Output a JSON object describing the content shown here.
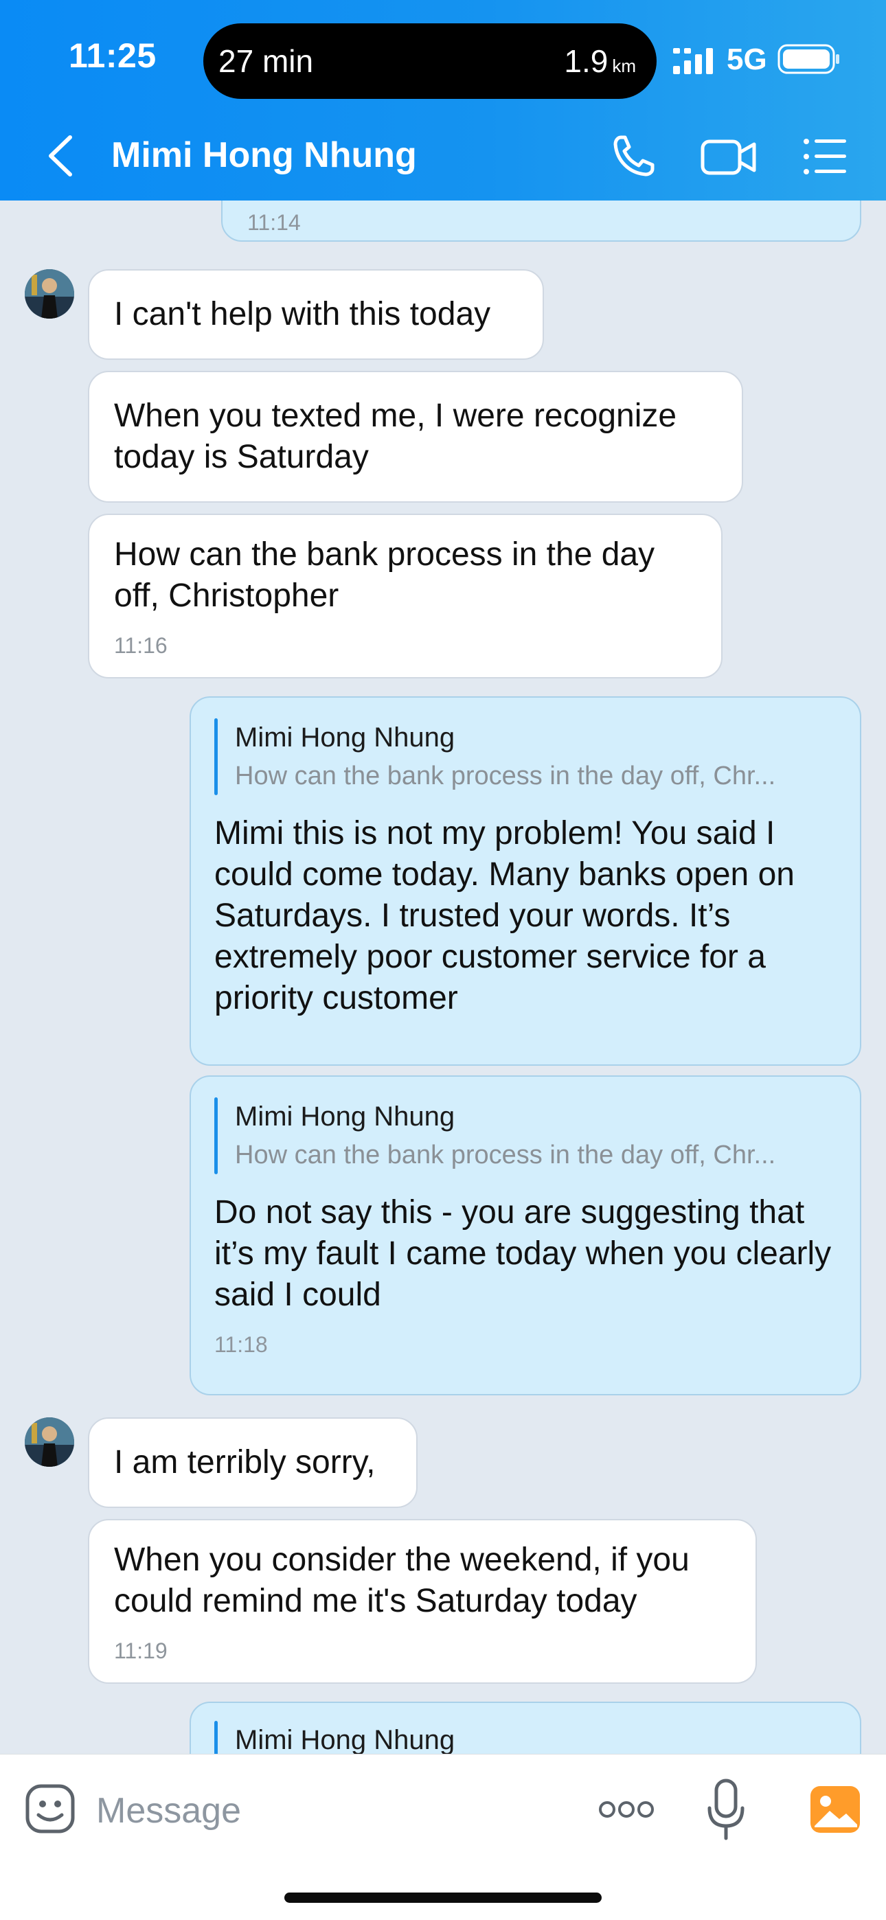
{
  "status_bar": {
    "time": "11:25",
    "island_left": "27 min",
    "island_distance": "1.9",
    "island_unit": "km",
    "network": "5G"
  },
  "nav": {
    "title": "Mimi Hong Nhung",
    "icons": [
      "back-icon",
      "phone-icon",
      "video-call-icon",
      "menu-list-icon"
    ]
  },
  "messages": [
    {
      "dir": "out",
      "time": "11:14"
    },
    {
      "dir": "in",
      "text": "I can't help with this today"
    },
    {
      "dir": "in",
      "text": "When you texted me, I were recognize today is Saturday"
    },
    {
      "dir": "in",
      "text": "How can the bank process in the day off, Christopher",
      "time": "11:16"
    },
    {
      "dir": "out",
      "reply_name": "Mimi Hong Nhung",
      "reply_text": "How can the bank process in the day off, Chr...",
      "text": "Mimi this is not my problem! You said I could come today. Many banks open on Saturdays. I trusted your words. It’s extremely poor customer service for a priority customer"
    },
    {
      "dir": "out",
      "reply_name": "Mimi Hong Nhung",
      "reply_text": "How can the bank process in the day off, Chr...",
      "text": "Do not say this - you are suggesting that it’s my fault I came today when you clearly said I could",
      "time": "11:18"
    },
    {
      "dir": "in",
      "text": "I am terribly sorry,"
    },
    {
      "dir": "in",
      "text": "When you consider the weekend, if you could remind me it's Saturday today",
      "time": "11:19"
    },
    {
      "dir": "out",
      "reply_name": "Mimi Hong Nhung"
    }
  ],
  "input": {
    "placeholder": "Message",
    "value": ""
  },
  "colors": {
    "header_start": "#0a8bf5",
    "header_end": "#2aa6ee",
    "chat_bg": "#e2e9f1",
    "incoming_bubble": "#ffffff",
    "outgoing_bubble": "#d3eefc",
    "photo_icon": "#ff9c2a"
  }
}
